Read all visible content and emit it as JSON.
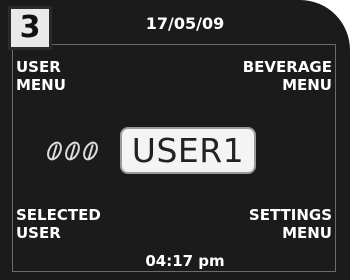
{
  "step": "3",
  "date": "17/05/09",
  "time": "04:17 pm",
  "user_menu": {
    "line1": "USER",
    "line2": "MENU"
  },
  "beverage_menu": {
    "line1": "BEVERAGE",
    "line2": "MENU"
  },
  "selected_user": {
    "line1": "SELECTED",
    "line2": "USER"
  },
  "settings_menu": {
    "line1": "SETTINGS",
    "line2": "MENU"
  },
  "current_user": "USER1",
  "strength_icon": "coffee-bean-icon",
  "strength_level": 3,
  "colors": {
    "screen_background": "#1b1b1b",
    "text": "#ffffff",
    "user_box_background": "#f4f4f4"
  }
}
